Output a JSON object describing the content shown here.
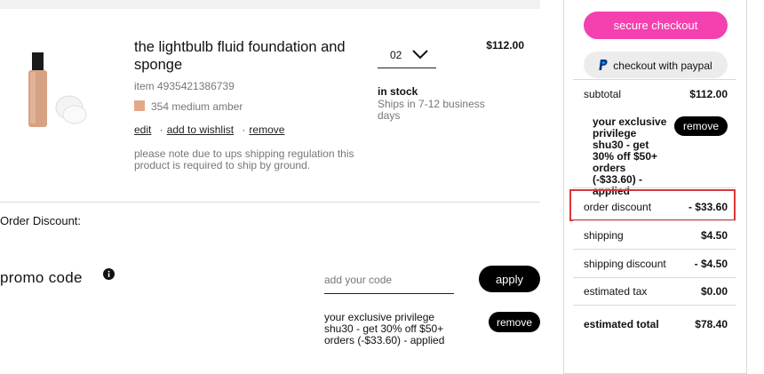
{
  "product": {
    "image": "foundation-bottle-and-sponge",
    "name": "the lightbulb fluid foundation and sponge",
    "item_number": "item 4935421386739",
    "shade_color": "#e3a88a",
    "shade_name": "354 medium amber",
    "actions": {
      "edit": "edit",
      "wishlist": "add to wishlist",
      "remove": "remove"
    },
    "shipping_note": "please note due to ups shipping regulation this product is required to ship by ground.",
    "quantity": "02",
    "stock_status": "in stock",
    "ships_text": "Ships in 7-12 business days",
    "price": "$112.00"
  },
  "order_discount_title": "Order Discount:",
  "promo": {
    "label": "promo code",
    "input_placeholder": "add your code",
    "apply_label": "apply",
    "applied_text": "your exclusive privilege shu30 - get 30% off $50+ orders (-$33.60) - applied",
    "remove_label": "remove"
  },
  "summary": {
    "secure_checkout_label": "secure checkout",
    "paypal_label": "checkout with paypal",
    "subtotal_label": "subtotal",
    "subtotal_value": "$112.00",
    "promo_desc": "your exclusive privilege shu30 - get 30% off $50+ orders (-$33.60) - applied",
    "promo_remove_label": "remove",
    "order_discount_label": "order discount",
    "order_discount_value": "- $33.60",
    "shipping_label": "shipping",
    "shipping_value": "$4.50",
    "shipping_discount_label": "shipping discount",
    "shipping_discount_value": "- $4.50",
    "tax_label": "estimated tax",
    "tax_value": "$0.00",
    "total_label": "estimated total",
    "total_value": "$78.40"
  },
  "colors": {
    "accent_pink": "#f540b0",
    "highlight_red": "#e03535",
    "button_black": "#000000",
    "paypal_blue": "#003087"
  }
}
